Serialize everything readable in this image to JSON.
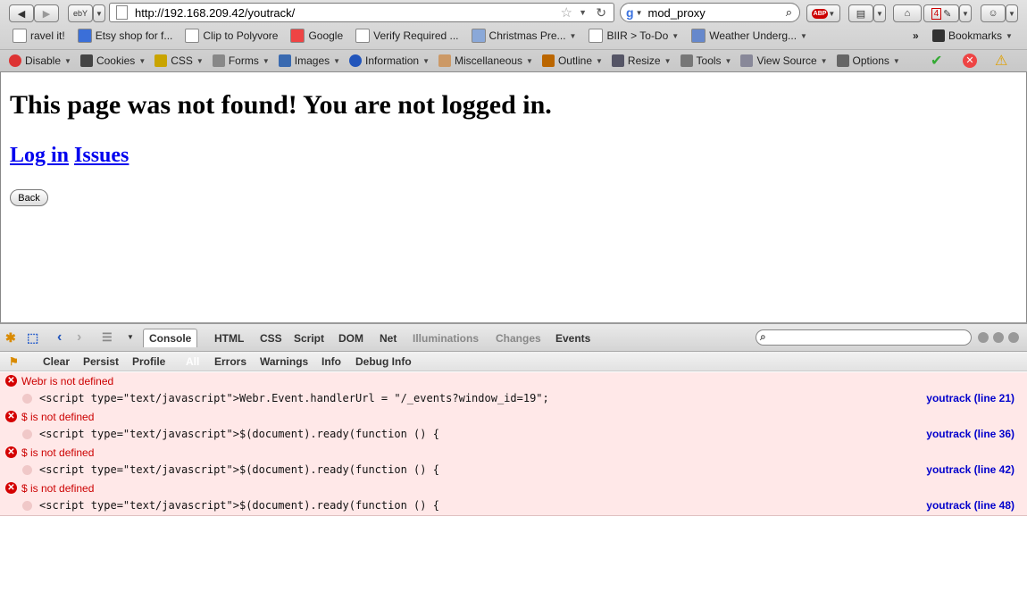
{
  "toolbar": {
    "url": "http://192.168.209.42/youtrack/",
    "search_engine": "Google",
    "search_value": "mod_proxy",
    "abp_label": "ABP",
    "badge_count": "4"
  },
  "bookmarks": [
    {
      "label": "ravel it!",
      "icon": "page-icon"
    },
    {
      "label": "Etsy shop for f...",
      "icon": "rss-icon"
    },
    {
      "label": "Clip to Polyvore",
      "icon": "page-icon"
    },
    {
      "label": "Google",
      "icon": "google-icon"
    },
    {
      "label": "Verify Required ...",
      "icon": "page-icon"
    },
    {
      "label": "Christmas Pre...",
      "icon": "folder-icon"
    },
    {
      "label": "BIIR > To-Do",
      "icon": "page-icon"
    },
    {
      "label": "Weather Underg...",
      "icon": "weather-icon"
    }
  ],
  "bookmarks_menu": "Bookmarks",
  "webdev": [
    {
      "label": "Disable",
      "icon": "disable-icon"
    },
    {
      "label": "Cookies",
      "icon": "cookies-icon"
    },
    {
      "label": "CSS",
      "icon": "css-icon"
    },
    {
      "label": "Forms",
      "icon": "forms-icon"
    },
    {
      "label": "Images",
      "icon": "images-icon"
    },
    {
      "label": "Information",
      "icon": "information-icon"
    },
    {
      "label": "Miscellaneous",
      "icon": "misc-icon"
    },
    {
      "label": "Outline",
      "icon": "outline-icon"
    },
    {
      "label": "Resize",
      "icon": "resize-icon"
    },
    {
      "label": "Tools",
      "icon": "tools-icon"
    },
    {
      "label": "View Source",
      "icon": "source-icon"
    },
    {
      "label": "Options",
      "icon": "options-icon"
    }
  ],
  "page": {
    "heading": "This page was not found! You are not logged in.",
    "link_login": "Log in",
    "link_issues": "Issues",
    "back_button": "Back"
  },
  "firebug": {
    "tabs": [
      "Console",
      "HTML",
      "CSS",
      "Script",
      "DOM",
      "Net",
      "Illuminations",
      "Changes",
      "Events"
    ],
    "sub": [
      "Clear",
      "Persist",
      "Profile",
      "All",
      "Errors",
      "Warnings",
      "Info",
      "Debug Info"
    ],
    "logs": [
      {
        "message": "Webr is not defined",
        "code": "<script type=\"text/javascript\">Webr.Event.handlerUrl = \"/_events?window_id=19\";",
        "source": "youtrack (line 21)"
      },
      {
        "message": "$ is not defined",
        "code": "<script type=\"text/javascript\">$(document).ready(function () {",
        "source": "youtrack (line 36)"
      },
      {
        "message": "$ is not defined",
        "code": "<script type=\"text/javascript\">$(document).ready(function () {",
        "source": "youtrack (line 42)"
      },
      {
        "message": "$ is not defined",
        "code": "<script type=\"text/javascript\">$(document).ready(function () {",
        "source": "youtrack (line 48)"
      }
    ]
  },
  "colors": {
    "link": "#0000ee",
    "error": "#cc0000",
    "error_bg": "#ffe8e8"
  }
}
